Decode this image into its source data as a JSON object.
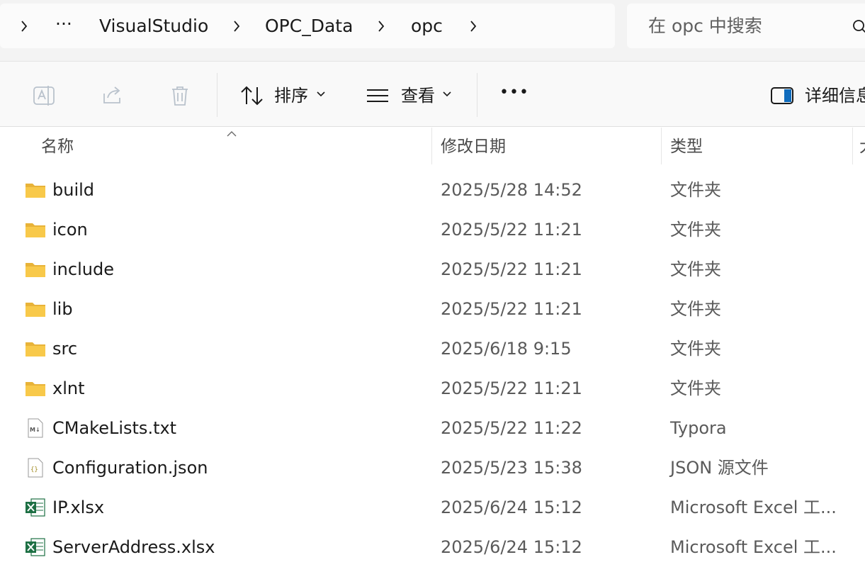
{
  "breadcrumb": {
    "more": "···",
    "items": [
      "VisualStudio",
      "OPC_Data",
      "opc"
    ]
  },
  "search": {
    "placeholder": "在 opc 中搜索"
  },
  "toolbar": {
    "sort_label": "排序",
    "view_label": "查看",
    "more_label": "•••",
    "details_label": "详细信息"
  },
  "columns": {
    "name": "名称",
    "date": "修改日期",
    "type": "类型",
    "size": "大"
  },
  "files": [
    {
      "name": "build",
      "date": "2025/5/28 14:52",
      "type": "文件夹",
      "icon": "folder-icon"
    },
    {
      "name": "icon",
      "date": "2025/5/22 11:21",
      "type": "文件夹",
      "icon": "folder-icon"
    },
    {
      "name": "include",
      "date": "2025/5/22 11:21",
      "type": "文件夹",
      "icon": "folder-icon"
    },
    {
      "name": "lib",
      "date": "2025/5/22 11:21",
      "type": "文件夹",
      "icon": "folder-icon"
    },
    {
      "name": "src",
      "date": "2025/6/18 9:15",
      "type": "文件夹",
      "icon": "folder-icon"
    },
    {
      "name": "xlnt",
      "date": "2025/5/22 11:21",
      "type": "文件夹",
      "icon": "folder-icon"
    },
    {
      "name": "CMakeLists.txt",
      "date": "2025/5/22 11:22",
      "type": "Typora",
      "icon": "markdown-file-icon"
    },
    {
      "name": "Configuration.json",
      "date": "2025/5/23 15:38",
      "type": "JSON 源文件",
      "icon": "json-file-icon"
    },
    {
      "name": "IP.xlsx",
      "date": "2025/6/24 15:12",
      "type": "Microsoft Excel 工...",
      "icon": "excel-file-icon"
    },
    {
      "name": "ServerAddress.xlsx",
      "date": "2025/6/24 15:12",
      "type": "Microsoft Excel 工...",
      "icon": "excel-file-icon"
    }
  ],
  "colors": {
    "folder": "#f8c94a",
    "folder_dark": "#e8b339",
    "excel": "#1d7044",
    "accent": "#0f6cbd"
  }
}
